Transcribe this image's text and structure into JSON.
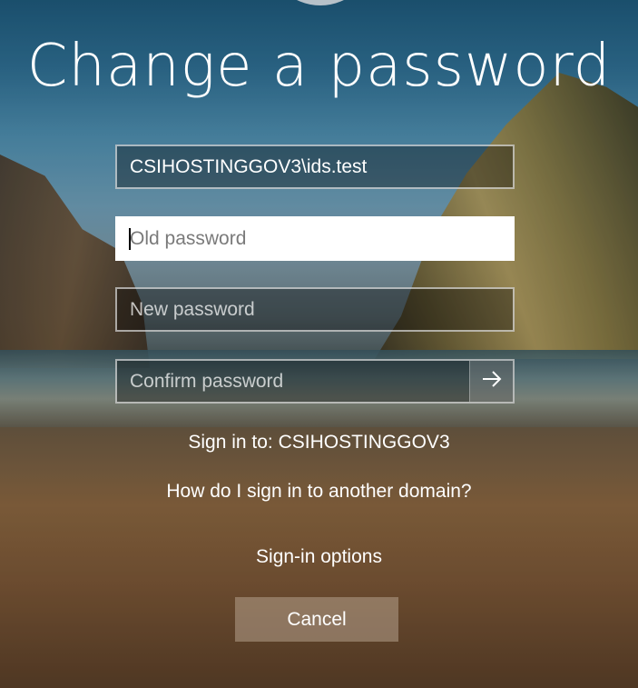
{
  "page": {
    "title": "Change a password"
  },
  "form": {
    "username_value": "CSIHOSTINGGOV3\\ids.test",
    "old_password_placeholder": "Old password",
    "new_password_placeholder": "New password",
    "confirm_password_placeholder": "Confirm password",
    "submit_icon": "arrow-right-icon"
  },
  "links": {
    "sign_in_to": "Sign in to: CSIHOSTINGGOV3",
    "other_domain": "How do I sign in to another domain?",
    "sign_in_options": "Sign-in options"
  },
  "buttons": {
    "cancel": "Cancel"
  },
  "colors": {
    "text": "#ffffff",
    "input_active_bg": "#ffffff"
  }
}
